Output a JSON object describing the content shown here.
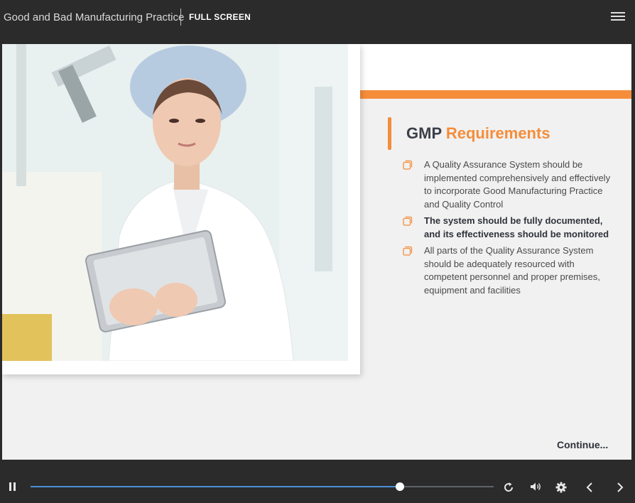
{
  "topbar": {
    "title": "Good and Bad Manufacturing Practice",
    "fullscreen_label": "FULL SCREEN",
    "menu_icon": "hamburger-menu-icon"
  },
  "slide": {
    "image": "woman-in-lab-coat-with-tablet-photo",
    "heading_part1": "GMP",
    "heading_part2": "Requirements",
    "bullet_icon": "copy-squares-icon",
    "bullets": [
      "A Quality Assurance System should be implemented comprehensively and effectively to incorporate Good Manufacturing Practice and Quality Control",
      "The system should be fully documented, and its effectiveness should be monitored",
      "All parts of the Quality Assurance System should be adequately resourced with competent personnel and proper premises, equipment and facilities"
    ],
    "continue_label": "Continue..."
  },
  "player": {
    "progress": 0.797,
    "icons": [
      "pause-icon",
      "replay-icon",
      "volume-icon",
      "settings-gear-icon",
      "previous-arrow-icon",
      "next-arrow-icon"
    ]
  },
  "colors": {
    "accent": "#f58d3b",
    "progress": "#4c8fd6",
    "bar_bg": "#2b2b2b",
    "slide_bg": "#f1f1f1"
  }
}
